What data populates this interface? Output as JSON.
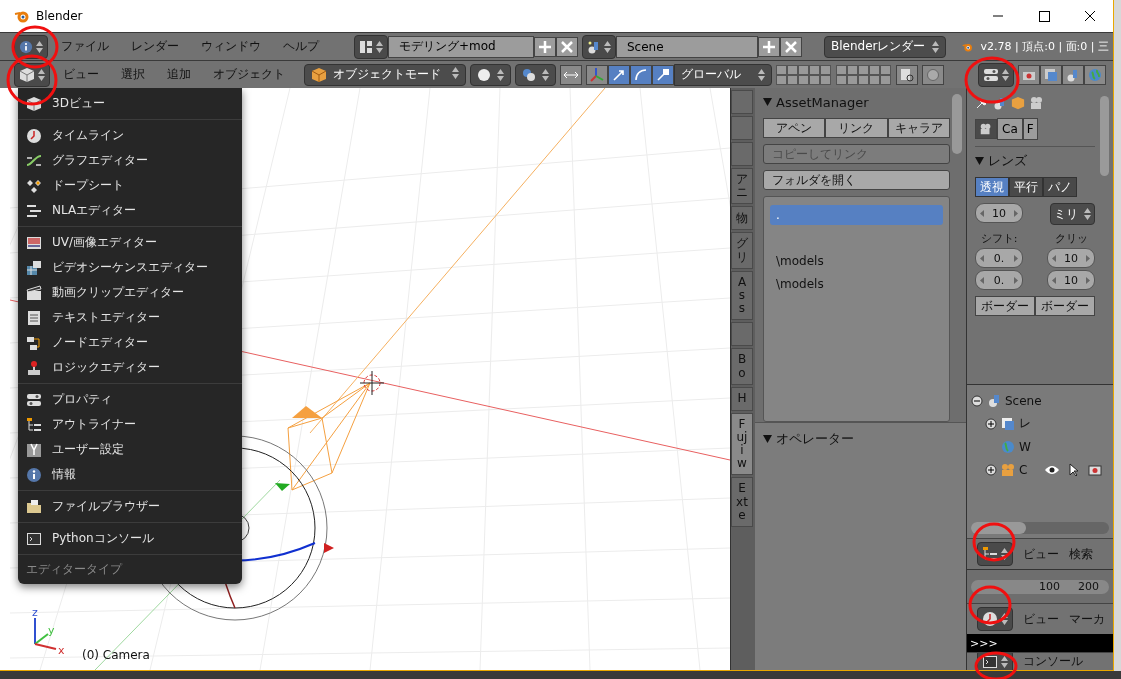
{
  "window": {
    "title": "Blender"
  },
  "info_header": {
    "menus": [
      "ファイル",
      "レンダー",
      "ウィンドウ",
      "ヘルプ"
    ],
    "layout": "モデリング+mod",
    "scene": "Scene",
    "engine": "Blenderレンダー",
    "stats": "v2.78 | 頂点:0 | 面:0 | 三"
  },
  "view3d_header": {
    "menus": [
      "ビュー",
      "選択",
      "追加",
      "オブジェクト"
    ],
    "mode": "オブジェクトモード",
    "orientation": "グローバル",
    "manipulators": [
      {
        "kind": "translate",
        "selected": true
      },
      {
        "kind": "rotate",
        "selected": true
      },
      {
        "kind": "scale",
        "selected": true
      }
    ]
  },
  "viewport": {
    "object": "(0) Camera",
    "axes": [
      "z",
      "y",
      "x"
    ]
  },
  "editor_menu": {
    "groups": [
      [
        {
          "kind": "view3d",
          "label": "3Dビュー"
        }
      ],
      [
        {
          "kind": "timeline",
          "label": "タイムライン"
        },
        {
          "kind": "graph",
          "label": "グラフエディター"
        },
        {
          "kind": "dopesheet",
          "label": "ドープシート"
        },
        {
          "kind": "nla",
          "label": "NLAエディター"
        }
      ],
      [
        {
          "kind": "image",
          "label": "UV/画像エディター"
        },
        {
          "kind": "sequencer",
          "label": "ビデオシーケンスエディター"
        },
        {
          "kind": "clip",
          "label": "動画クリップエディター"
        },
        {
          "kind": "text",
          "label": "テキストエディター"
        },
        {
          "kind": "node",
          "label": "ノードエディター"
        },
        {
          "kind": "logic",
          "label": "ロジックエディター"
        }
      ],
      [
        {
          "kind": "properties",
          "label": "プロパティ"
        },
        {
          "kind": "outliner",
          "label": "アウトライナー"
        },
        {
          "kind": "prefs",
          "label": "ユーザー設定"
        },
        {
          "kind": "info",
          "label": "情報"
        }
      ],
      [
        {
          "kind": "files",
          "label": "ファイルブラウザー"
        }
      ],
      [
        {
          "kind": "console",
          "label": "Pythonコンソール"
        }
      ]
    ],
    "footer": "エディタータイプ"
  },
  "tool_shelf": {
    "tabs": [
      {
        "selected": false
      },
      {
        "selected": false
      },
      {
        "selected": false
      },
      {
        "label": "アニ",
        "selected": false
      },
      {
        "label": "物",
        "selected": false
      },
      {
        "label": "グリ",
        "selected": false
      },
      {
        "label": "Ass",
        "selected": false
      },
      {
        "selected": false
      },
      {
        "label": "Bo",
        "selected": false
      },
      {
        "label": "H",
        "selected": false
      },
      {
        "label": "Fujiw",
        "selected": true
      },
      {
        "label": "Exte",
        "selected": false
      }
    ],
    "asset_manager": {
      "title": "AssetManager",
      "buttons": [
        "アペン",
        "リンク",
        "キャラア"
      ],
      "copy_link": {
        "label": "コピーしてリンク",
        "disabled": true
      },
      "open_folder": "フォルダを開く",
      "list": [
        {
          "label": ".",
          "selected": true
        },
        {
          "selected": false
        },
        {
          "label": "\\models",
          "selected": false
        },
        {
          "label": "\\models",
          "selected": false
        }
      ]
    },
    "operator_panel": "オペレーター"
  },
  "properties": {
    "datablock": [
      "Ca",
      "F"
    ],
    "lens_panel": "レンズ",
    "lens_types": [
      {
        "label": "透視",
        "selected": true
      },
      {
        "label": "平行",
        "selected": false
      },
      {
        "label": "パノ",
        "selected": false
      }
    ],
    "focal": "10",
    "unit": "ミリ",
    "shift_label": "シフト:",
    "clip_label": "クリッ",
    "shift": [
      "0.",
      "0."
    ],
    "clip": [
      "10",
      "10"
    ],
    "border_buttons": [
      "ボーダー",
      "ボーダー"
    ]
  },
  "outliner": {
    "tree": [
      {
        "label": "Scene",
        "kind": "scene",
        "expanded": true,
        "children": [
          {
            "label": "レ",
            "kind": "layers",
            "expanded": false
          },
          {
            "label": "W",
            "kind": "world"
          },
          {
            "label": "C",
            "kind": "camera",
            "expanded": false
          }
        ]
      }
    ],
    "header": [
      "ビュー",
      "検索"
    ]
  },
  "timeline": {
    "ruler": [
      "100",
      "200"
    ],
    "header": [
      "ビュー",
      "マーカ"
    ]
  },
  "console": {
    "prompt": ">>>",
    "header": "コンソール"
  }
}
